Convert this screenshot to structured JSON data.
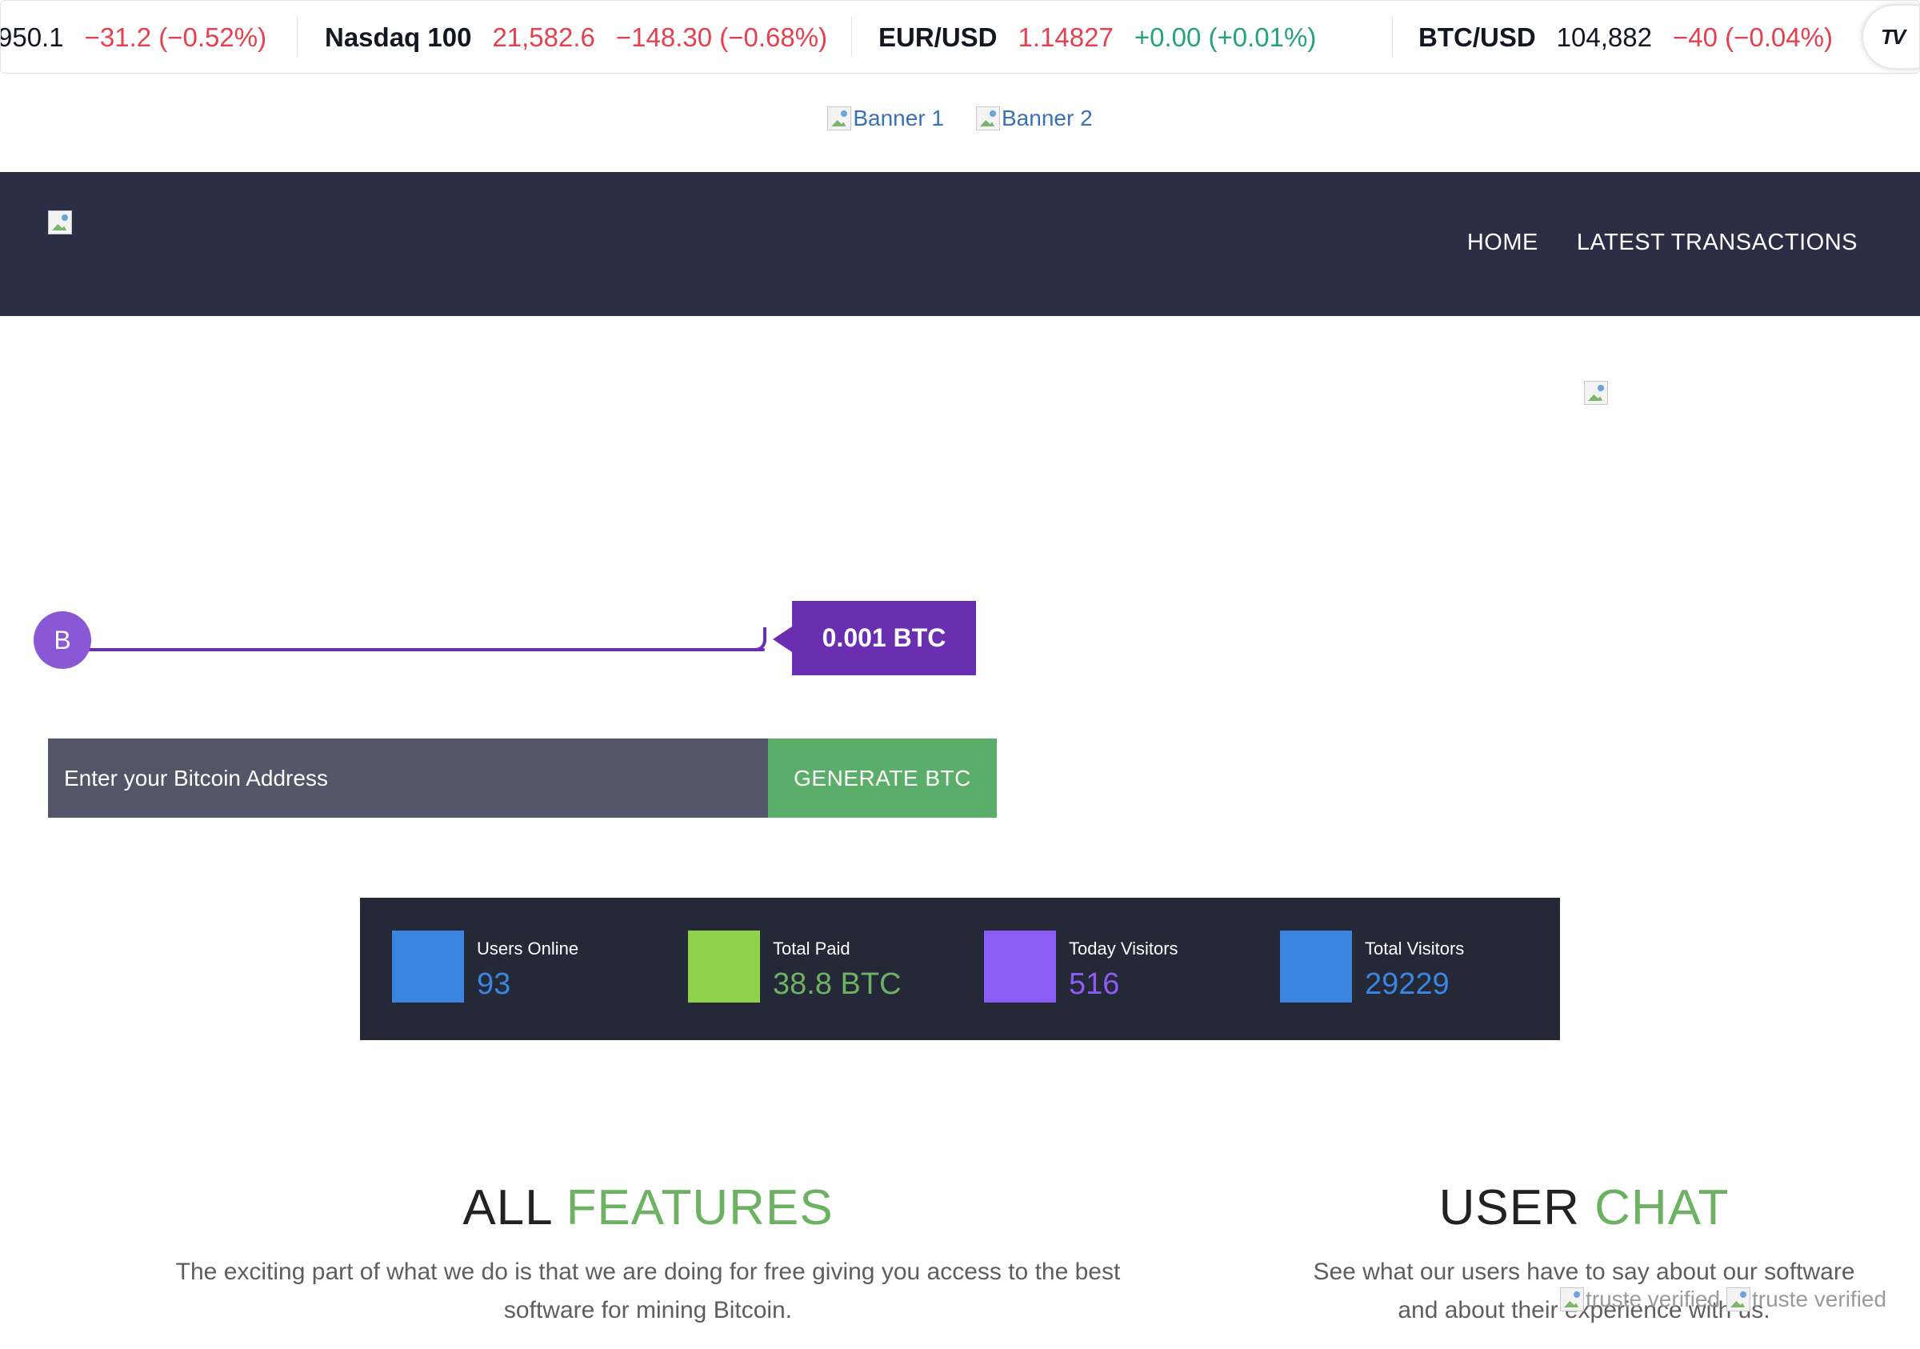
{
  "ticker": [
    {
      "symbol": "",
      "price": "950.1",
      "change": "−31.2 (−0.52%)"
    },
    {
      "symbol": "Nasdaq 100",
      "price": "21,582.6",
      "change": "−148.30 (−0.68%)"
    },
    {
      "symbol": "EUR/USD",
      "price": "1.14827",
      "change": "+0.00 (+0.01%)"
    },
    {
      "symbol": "BTC/USD",
      "price": "104,882",
      "change": "−40 (−0.04%)"
    }
  ],
  "ticker_logo": "TV",
  "banners": [
    "Banner 1",
    "Banner 2"
  ],
  "nav": {
    "home": "HOME",
    "latest": "LATEST TRANSACTIONS"
  },
  "slider": {
    "handle_label": "B",
    "amount": "0.001 BTC"
  },
  "form": {
    "placeholder": "Enter your Bitcoin Address",
    "button": "GENERATE BTC"
  },
  "stats": [
    {
      "label": "Users Online",
      "value": "93",
      "color": "#3a85e0"
    },
    {
      "label": "Total Paid",
      "value": "38.8 BTC",
      "color": "#8ed34b"
    },
    {
      "label": "Today Visitors",
      "value": "516",
      "color": "#8b5cf6"
    },
    {
      "label": "Total Visitors",
      "value": "29229",
      "color": "#3a85e0"
    }
  ],
  "features": {
    "title_1": "ALL",
    "title_2": "FEATURES",
    "desc_1": "The exciting part of what we do is that we are doing for free giving you access to the best",
    "desc_2": "software for mining Bitcoin."
  },
  "chat": {
    "title_1": "USER",
    "title_2": "CHAT",
    "desc_1": "See what our users have to say about our software",
    "desc_2": "and about their experience with us."
  },
  "truste": [
    "truste verified",
    "truste verified"
  ],
  "colors": {
    "navbar": "#2a2f45",
    "accent_green": "#6cb262",
    "slider_purple": "#6a2fb0"
  }
}
